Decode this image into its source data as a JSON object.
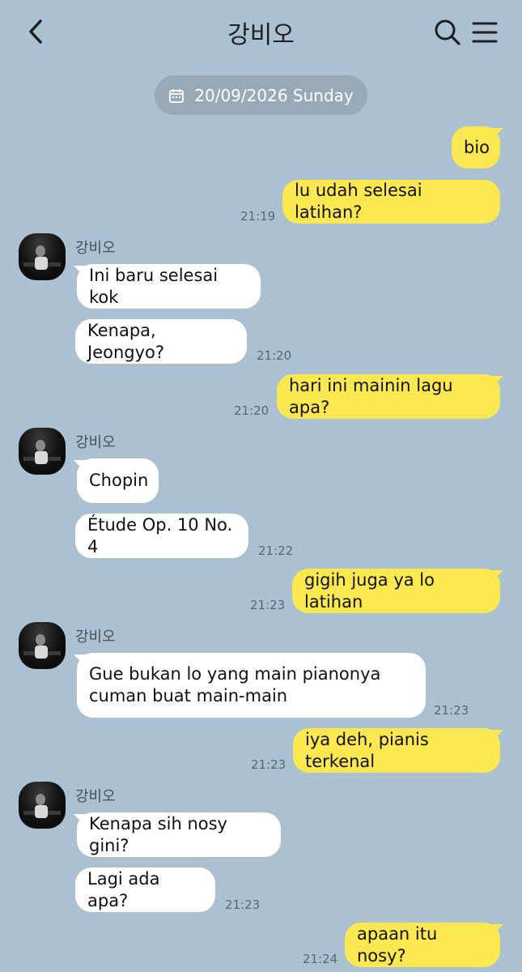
{
  "header": {
    "title": "강비오"
  },
  "date_label": "20/09/2026 Sunday",
  "contact_name": "강비오",
  "messages": {
    "m1": "bio",
    "m2": "lu udah selesai latihan?",
    "t1": "21:19",
    "m3": "Ini baru selesai kok",
    "m4": "Kenapa, Jeongyo?",
    "t2": "21:20",
    "m5": "hari ini mainin lagu apa?",
    "t3": "21:20",
    "m6": "Chopin",
    "m7": "Étude Op. 10 No. 4",
    "t4": "21:22",
    "m8": "gigih juga ya lo latihan",
    "t5": "21:23",
    "m9a": "Gue bukan lo yang main pianonya",
    "m9b": "cuman buat main-main",
    "t6": "21:23",
    "m10": "iya deh, pianis terkenal",
    "t7": "21:23",
    "m11": "Kenapa sih nosy gini?",
    "m12": "Lagi ada apa?",
    "t8": "21:23",
    "m13": "apaan itu nosy?",
    "t9": "21:24"
  },
  "icons": [
    "back-arrow-icon",
    "search-icon",
    "menu-icon",
    "calendar-icon"
  ],
  "colors": {
    "background": "#abc1d1",
    "my_bubble": "#fbe850",
    "their_bubble": "#ffffff",
    "date_pill": "#98a9b7"
  }
}
